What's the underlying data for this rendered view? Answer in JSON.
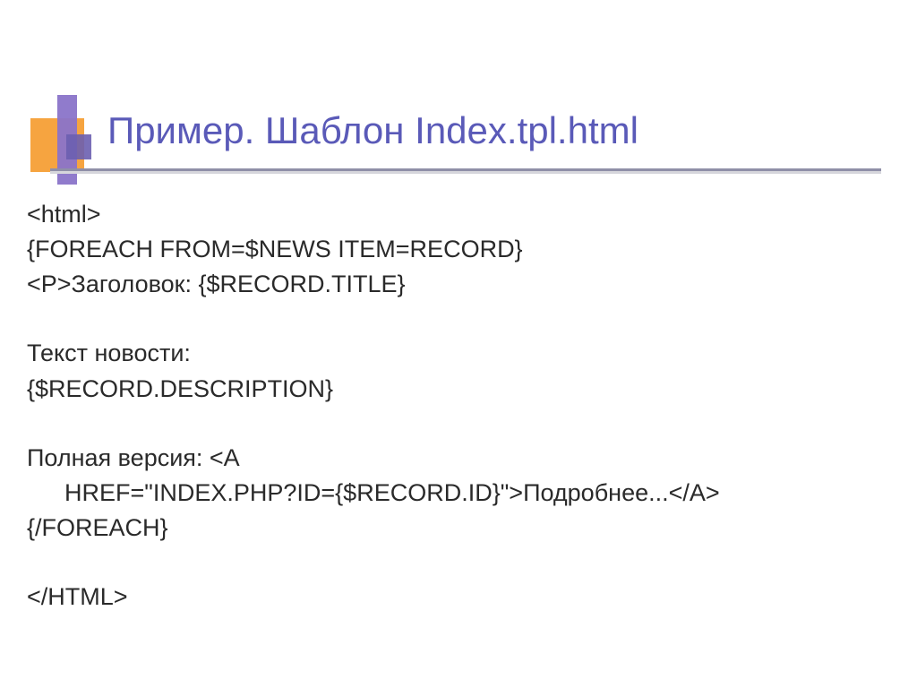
{
  "slide": {
    "title": "Пример. Шаблон Index.tpl.html",
    "lines": {
      "l1": "<html>",
      "l2": "{FOREACH FROM=$NEWS ITEM=RECORD}",
      "l3": "<P>Заголовок: {$RECORD.TITLE}",
      "l4": "Текст новости:",
      "l5": " {$RECORD.DESCRIPTION}",
      "l6": "Полная версия: <A",
      "l7": "HREF=\"INDEX.PHP?ID={$RECORD.ID}\">Подробнее...</A>",
      "l8": "{/FOREACH}",
      "l9": "</HTML>"
    }
  }
}
